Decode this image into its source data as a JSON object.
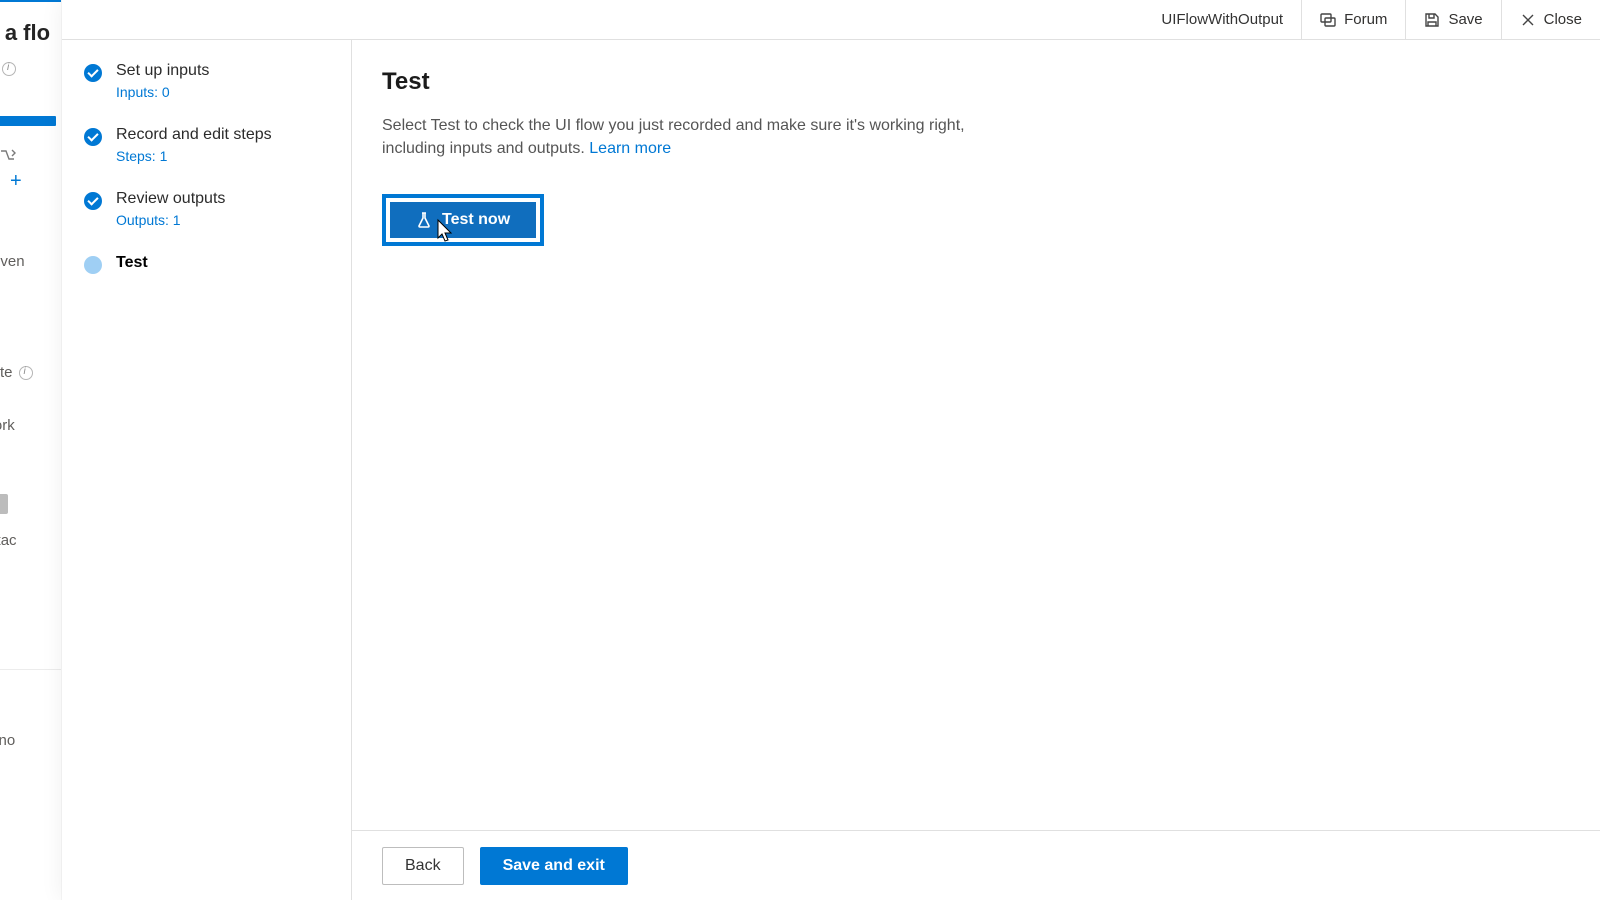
{
  "under": {
    "title": "ake a flo",
    "line_events": "gnated even",
    "line_template": "plate",
    "line_remote": "ote work",
    "line_email_attach": "email attac",
    "line_email_note": "email a no"
  },
  "header": {
    "flow_name": "UIFlowWithOutput",
    "forum": "Forum",
    "save": "Save",
    "close": "Close"
  },
  "steps": [
    {
      "label": "Set up inputs",
      "sub": "Inputs: 0",
      "state": "done"
    },
    {
      "label": "Record and edit steps",
      "sub": "Steps: 1",
      "state": "done"
    },
    {
      "label": "Review outputs",
      "sub": "Outputs: 1",
      "state": "done"
    },
    {
      "label": "Test",
      "sub": "",
      "state": "current"
    }
  ],
  "main": {
    "heading": "Test",
    "description": "Select Test to check the UI flow you just recorded and make sure it's working right, including inputs and outputs. ",
    "learn_more": "Learn more",
    "test_now": "Test now"
  },
  "footer": {
    "back": "Back",
    "save_exit": "Save and exit"
  }
}
